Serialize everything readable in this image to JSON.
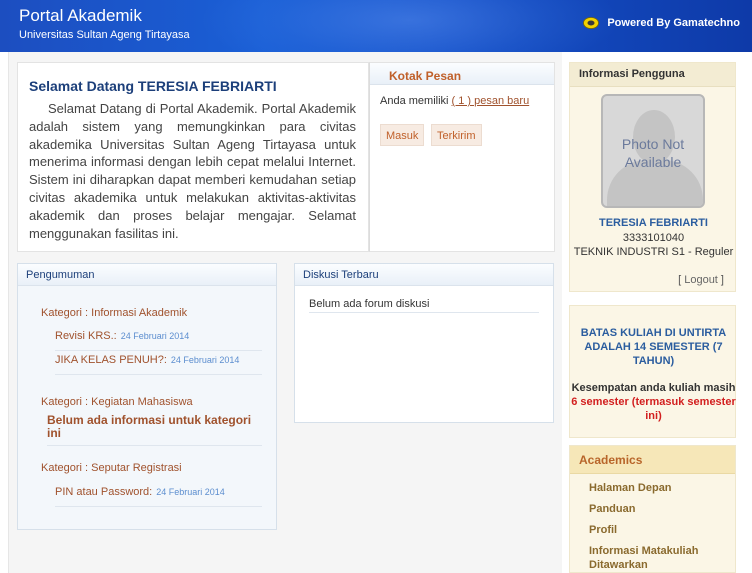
{
  "header": {
    "app_title": "Portal Akademik",
    "app_subtitle": "Universitas Sultan Ageng Tirtayasa",
    "powered_by": "Powered By Gamatechno",
    "logo_icon": "gamatechno-logo-icon"
  },
  "welcome": {
    "title": "Selamat Datang TERESIA FEBRIARTI",
    "body": "Selamat Datang di Portal Akademik. Portal Akademik adalah sistem yang memungkinkan para civitas akademika Universitas Sultan Ageng Tirtayasa untuk menerima informasi dengan lebih cepat melalui Internet. Sistem ini diharapkan dapat memberi kemudahan setiap civitas akademika untuk melakukan aktivitas-aktivitas akademik dan proses belajar mengajar. Selamat menggunakan fasilitas ini."
  },
  "inbox": {
    "title": "Kotak Pesan",
    "message_prefix": "Anda memiliki",
    "message_link": "( 1 ) pesan baru",
    "btn_inbox": "Masuk",
    "btn_sent": "Terkirim"
  },
  "announcements": {
    "title": "Pengumuman",
    "categories": [
      {
        "label": "Kategori : Informasi Akademik",
        "items": [
          {
            "title": "Revisi KRS.:",
            "date": "24 Februari 2014"
          },
          {
            "title": "JIKA KELAS PENUH?:",
            "date": "24 Februari 2014"
          }
        ]
      },
      {
        "label": "Kategori : Kegiatan Mahasiswa",
        "empty": "Belum ada informasi untuk kategori ini"
      },
      {
        "label": "Kategori : Seputar Registrasi",
        "items": [
          {
            "title": "PIN atau Password:",
            "date": "24 Februari 2014"
          }
        ]
      }
    ]
  },
  "forum": {
    "title": "Diskusi Terbaru",
    "empty": "Belum ada forum diskusi"
  },
  "user_info": {
    "title": "Informasi Pengguna",
    "photo_text": "Photo Not Available",
    "name": "TERESIA FEBRIARTI",
    "nim": "3333101040",
    "program": "TEKNIK INDUSTRI S1 - Reguler",
    "logout_label": "Logout"
  },
  "notice": {
    "limit_text": "BATAS KULIAH DI UNTIRTA ADALAH 14 SEMESTER (7 TAHUN)",
    "chance_prefix": "Kesempatan anda kuliah masih",
    "chance_value": "6 semester (termasuk semester ini)"
  },
  "academics": {
    "title": "Academics",
    "links": [
      "Halaman Depan",
      "Panduan",
      "Profil",
      "Informasi Matakuliah Ditawarkan"
    ]
  },
  "colors": {
    "header_blue": "#1a5fd6",
    "accent_brown": "#a0522d",
    "link_blue": "#2b5d9f",
    "alert_red": "#d21f1f"
  }
}
